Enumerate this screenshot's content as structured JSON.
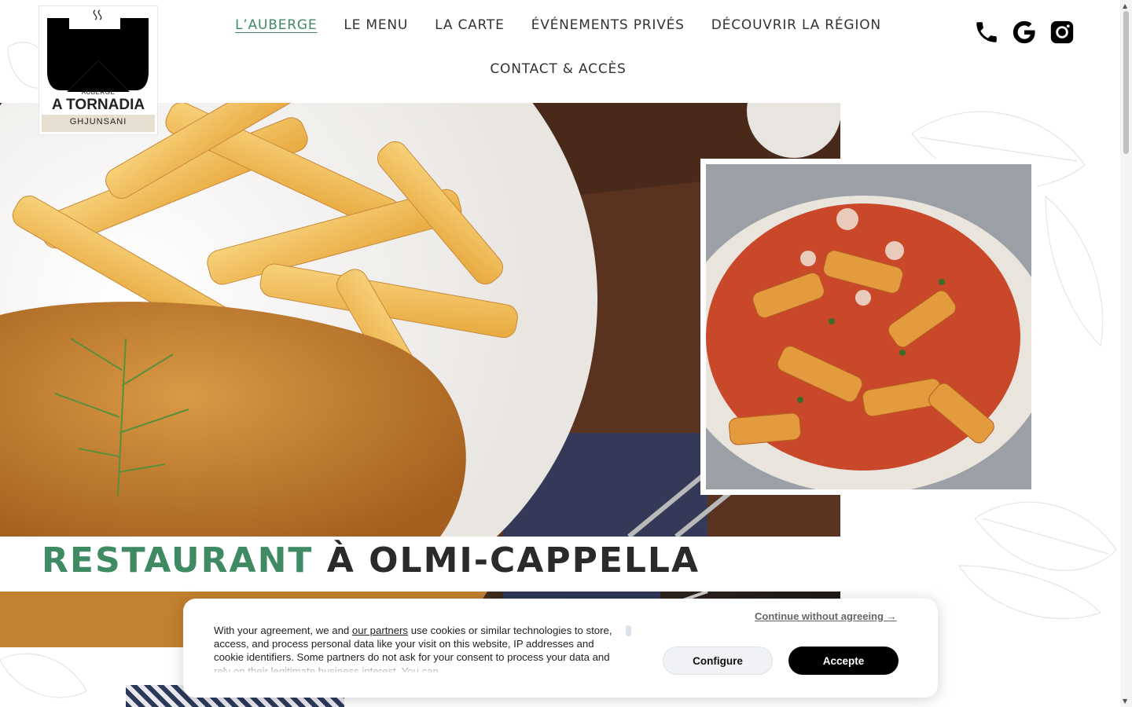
{
  "brand": {
    "logo_small": "AUBERGE",
    "logo_name": "A TORNADIA",
    "logo_sub": "GHJUNSANI"
  },
  "nav": {
    "items": [
      {
        "label": "L’AUBERGE",
        "active": true
      },
      {
        "label": "LE MENU"
      },
      {
        "label": "LA CARTE"
      },
      {
        "label": "ÉVÉNEMENTS PRIVÉS"
      },
      {
        "label": "DÉCOUVRIR LA RÉGION"
      },
      {
        "label": "CONTACT & ACCÈS"
      }
    ]
  },
  "social": {
    "icons": [
      "phone-icon",
      "google-icon",
      "instagram-icon"
    ]
  },
  "hero": {
    "title_accent": "RESTAURANT",
    "title_rest": "À OLMI-CAPPELLA"
  },
  "colors": {
    "accent": "#3f8a62",
    "text": "#2a2a2a"
  },
  "cookie": {
    "text_prefix": "With your agreement, we and ",
    "text_link": "our partners",
    "text_suffix": " use cookies or similar technologies to store, access, and process personal data like your visit on this website, IP addresses and cookie identifiers. Some partners do not ask for your consent to process your data and rely on their legitimate business interest. You can",
    "continue": "Continue without agreeing →",
    "configure": "Configure",
    "accept": "Accepte"
  }
}
